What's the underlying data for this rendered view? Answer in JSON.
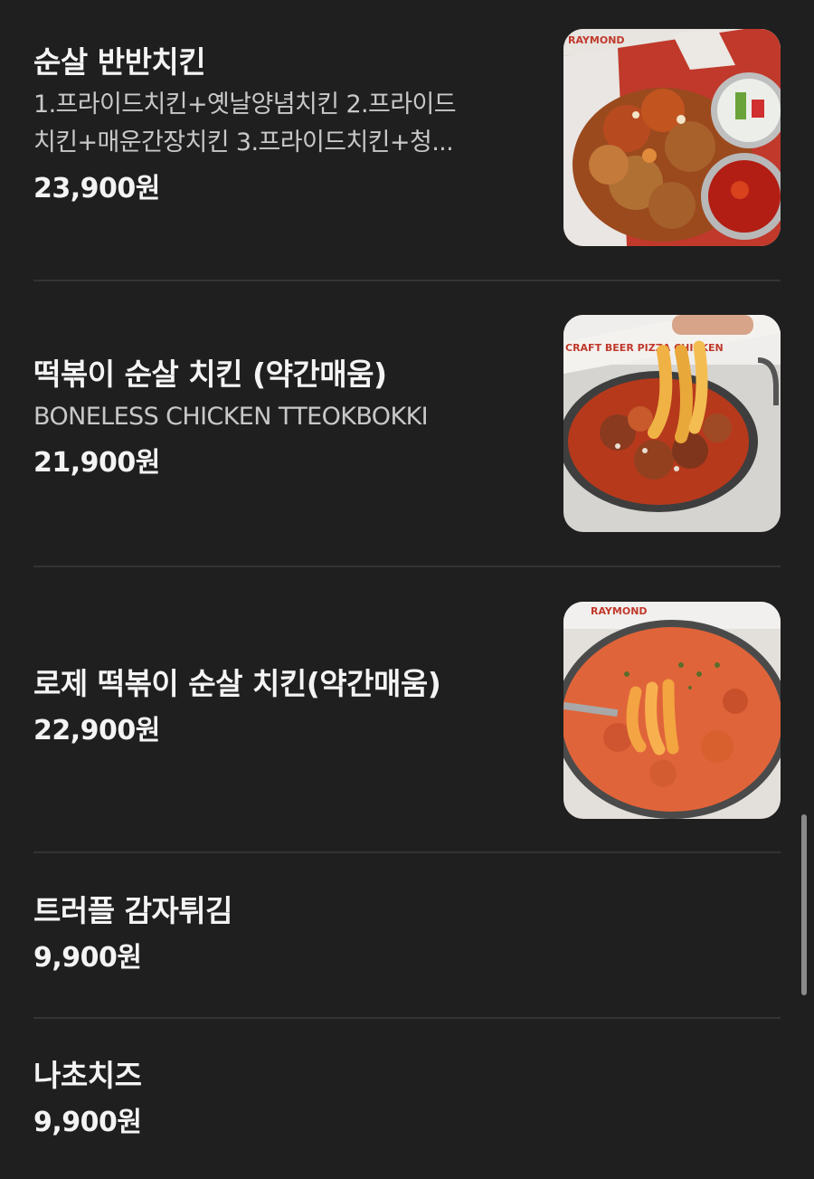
{
  "menu": {
    "items": [
      {
        "name": "순살 반반치킨",
        "desc_line1": "1.프라이드치킨+옛날양념치킨 2.프라이드",
        "desc_line2": "치킨+매운간장치킨 3.프라이드치킨+청...",
        "price": "23,900원",
        "image": "boneless-half-half-chicken-photo",
        "image_label": "RAYMOND"
      },
      {
        "name": "떡볶이 순살 치킨 (약간매움)",
        "desc": "BONELESS CHICKEN TTEOKBOKKI",
        "price": "21,900원",
        "image": "chicken-tteokbokki-photo",
        "image_label": "CRAFT BEER PIZZA CHICKEN"
      },
      {
        "name": "로제 떡볶이 순살 치킨(약간매움)",
        "price": "22,900원",
        "image": "rose-tteokbokki-chicken-photo",
        "image_label": "RAYMOND"
      },
      {
        "name": "트러플 감자튀김",
        "price": "9,900원"
      },
      {
        "name": "나초치즈",
        "price": "9,900원"
      }
    ]
  },
  "colors": {
    "background": "#1f1f1f",
    "text_primary": "#f4f4f4",
    "text_secondary": "#c8c8c8",
    "divider": "#333333"
  }
}
